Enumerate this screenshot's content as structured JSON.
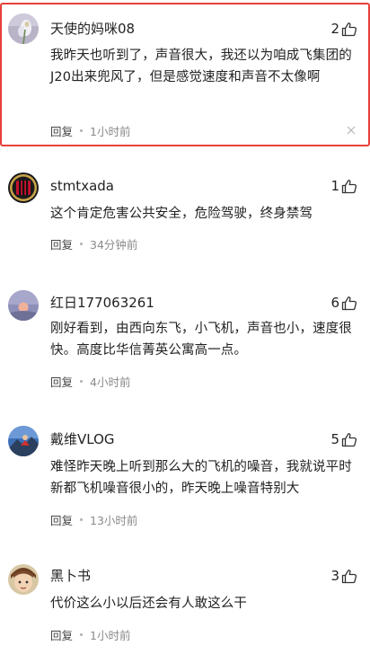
{
  "ui": {
    "reply_label": "回复",
    "highlight_color": "#e8403a"
  },
  "comments": [
    {
      "username": "天使的妈咪08",
      "likes": "2",
      "text": "我昨天也听到了，声音很大，我还以为咱成飞集团的J20出来兜风了，但是感觉速度和声音不太像啊",
      "time": "1小时前",
      "avatar_icon": "flower-photo-avatar"
    },
    {
      "username": "stmtxada",
      "likes": "1",
      "text": "这个肯定危害公共安全，危险驾驶，终身禁驾",
      "time": "34分钟前",
      "avatar_icon": "ac-milan-badge-avatar"
    },
    {
      "username": "红日177063261",
      "likes": "6",
      "text": "刚好看到，由西向东飞，小飞机，声音也小，速度很快。高度比华信菁英公寓高一点。",
      "time": "4小时前",
      "avatar_icon": "sunset-avatar"
    },
    {
      "username": "戴维VLOG",
      "likes": "5",
      "text": "难怪昨天晚上听到那么大的飞机的噪音，我就说平时新都飞机噪音很小的，昨天晚上噪音特别大",
      "time": "13小时前",
      "avatar_icon": "mountain-person-avatar"
    },
    {
      "username": "黑卜书",
      "likes": "3",
      "text": "代价这么小以后还会有人敢这么干",
      "time": "1小时前",
      "avatar_icon": "cartoon-face-avatar"
    }
  ]
}
